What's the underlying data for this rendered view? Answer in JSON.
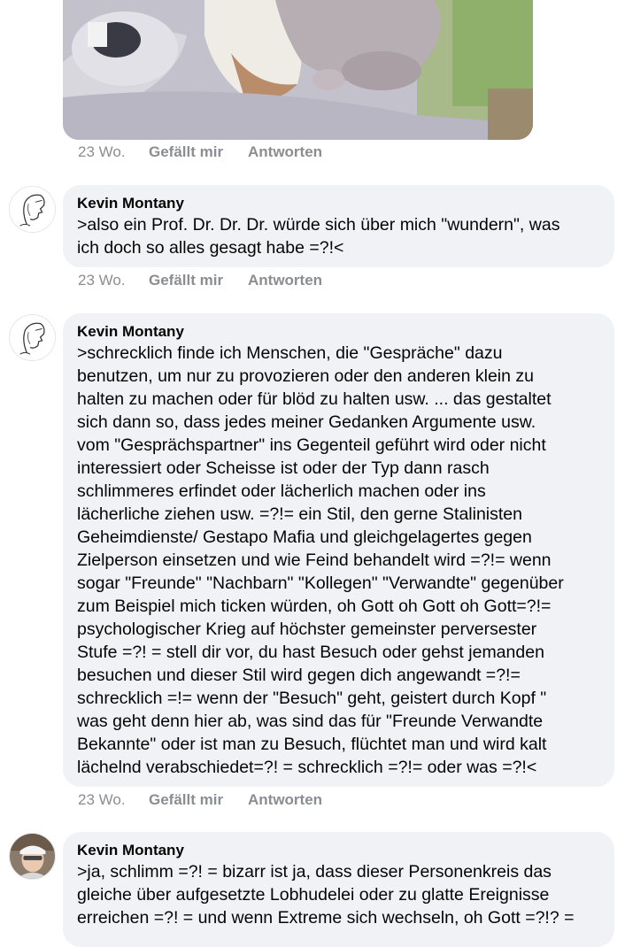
{
  "top_post": {
    "time": "23 Wo.",
    "like_label": "Gefällt mir",
    "reply_label": "Antworten"
  },
  "comments": [
    {
      "author": "Kevin Montany",
      "avatar_icon": "sketched-face-avatar",
      "text": ">also ein Prof. Dr. Dr. Dr. würde sich über mich \"wundern\", was\nich doch so alles gesagt habe =?!<",
      "time": "23 Wo.",
      "like_label": "Gefällt mir",
      "reply_label": "Antworten"
    },
    {
      "author": "Kevin Montany",
      "avatar_icon": "sketched-face-avatar",
      "text": ">schrecklich finde ich Menschen, die \"Gespräche\" dazu\nbenutzen, um nur zu provozieren oder den anderen klein zu\nhalten zu machen oder für blöd zu halten usw. ... das gestaltet\nsich dann so, dass jedes meiner Gedanken Argumente usw.\nvom \"Gesprächspartner\" ins Gegenteil geführt wird oder nicht\ninteressiert oder Scheisse ist oder der Typ dann rasch\nschlimmeres erfindet oder lächerlich machen oder ins\nlächerliche ziehen usw. =?!= ein Stil, den gerne Stalinisten\nGeheimdienste/ Gestapo Mafia und gleichgelagertes gegen\nZielperson einsetzen und wie Feind behandelt wird =?!= wenn\nsogar \"Freunde\" \"Nachbarn\" \"Kollegen\" \"Verwandte\" gegenüber\nzum Beispiel mich ticken würden, oh Gott oh Gott oh Gott=?!=\npsychologischer Krieg auf höchster gemeinster perversester\nStufe =?! = stell dir vor, du hast Besuch oder gehst jemanden\nbesuchen und dieser Stil wird gegen dich angewandt =?!=\nschrecklich =!= wenn der \"Besuch\" geht, geistert durch Kopf \"\nwas geht denn hier ab, was sind das für \"Freunde Verwandte\nBekannte\" oder ist man zu Besuch, flüchtet man und wird kalt\nlächelnd verabschiedet=?! = schrecklich =?!= oder was =?!<",
      "time": "23 Wo.",
      "like_label": "Gefällt mir",
      "reply_label": "Antworten"
    },
    {
      "author": "Kevin Montany",
      "avatar_icon": "profile-photo-avatar",
      "text": ">ja, schlimm =?! = bizarr ist ja, dass dieser Personenkreis das\ngleiche über aufgesetzte Lobhudelei oder zu glatte Ereignisse\nerreichen =?! = und wenn Extreme sich wechseln, oh Gott =?!? ="
    }
  ]
}
